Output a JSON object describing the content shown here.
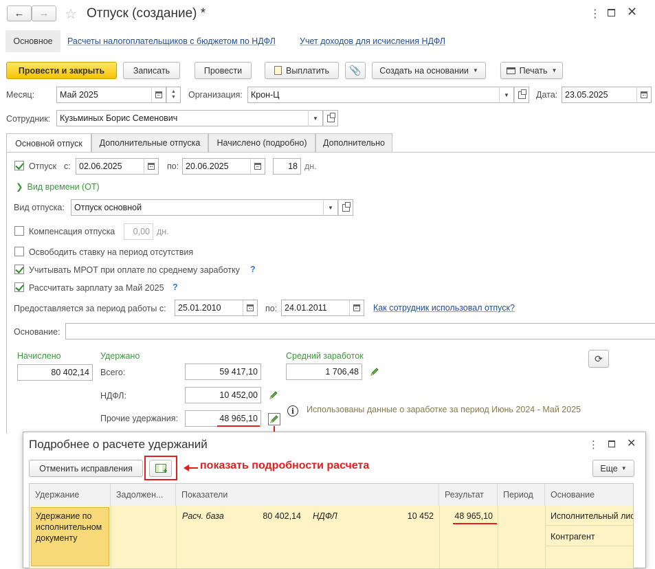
{
  "header": {
    "title": "Отпуск (создание) *",
    "nav_tabs": [
      "Основное",
      "Расчеты налогоплательщиков с бюджетом по НДФЛ",
      "Учет доходов для исчисления НДФЛ"
    ]
  },
  "toolbar": {
    "post_close": "Провести и закрыть",
    "save": "Записать",
    "post": "Провести",
    "pay": "Выплатить",
    "create_based": "Создать на основании",
    "print": "Печать"
  },
  "fields": {
    "month_label": "Месяц:",
    "month_value": "Май 2025",
    "org_label": "Организация:",
    "org_value": "Крон-Ц",
    "date_label": "Дата:",
    "date_value": "23.05.2025",
    "employee_label": "Сотрудник:",
    "employee_value": "Кузьминых Борис Семенович"
  },
  "tabs": [
    "Основной отпуск",
    "Дополнительные отпуска",
    "Начислено (подробно)",
    "Дополнительно"
  ],
  "vacation": {
    "label": "Отпуск",
    "from_label": "с:",
    "from_value": "02.06.2025",
    "to_label": "по:",
    "to_value": "20.06.2025",
    "days_value": "18",
    "days_unit": "дн.",
    "time_type": "Вид времени (ОТ)",
    "type_label": "Вид отпуска:",
    "type_value": "Отпуск основной",
    "compensation_label": "Компенсация отпуска",
    "compensation_value": "0,00",
    "compensation_unit": "дн.",
    "release_rate": "Освободить ставку на период отсутствия",
    "mrot": "Учитывать МРОТ при оплате по среднему заработку",
    "calc_salary": "Рассчитать зарплату за Май 2025",
    "q": "?",
    "period_label": "Предоставляется за период работы с:",
    "period_from": "25.01.2010",
    "period_to_label": "по:",
    "period_to": "24.01.2011",
    "how_used_link": "Как сотрудник использовал отпуск?",
    "basis_label": "Основание:"
  },
  "totals": {
    "accrued_label": "Начислено",
    "accrued_value": "80 402,14",
    "withheld_label": "Удержано",
    "total_label": "Всего:",
    "total_value": "59 417,10",
    "ndfl_label": "НДФЛ:",
    "ndfl_value": "10 452,00",
    "other_label": "Прочие удержания:",
    "other_value": "48 965,10",
    "avg_label": "Средний заработок",
    "avg_value": "1 706,48",
    "info_text": "Использованы данные о заработке за период Июнь 2024 - Май 2025"
  },
  "dialog": {
    "title": "Подробнее о расчете удержаний",
    "cancel_corrections": "Отменить исправления",
    "annotation": "показать подробности расчета",
    "more": "Еще",
    "columns": [
      "Удержание",
      "Задолжен...",
      "Показатели",
      "Результат",
      "Период",
      "Основание"
    ],
    "row": {
      "deduction": "Удержание по исполнительном документу",
      "indicator1_name": "Расч. база",
      "indicator1_value": "80 402,14",
      "indicator2_name": "НДФЛ",
      "indicator2_value": "10 452",
      "result": "48 965,10",
      "basis1": "Исполнительный лист",
      "basis2": "Контрагент"
    }
  },
  "colors": {
    "accent_yellow": "#f5c400",
    "green": "#3a9a3a",
    "link": "#1f4e9c",
    "red_annotation": "#e02020",
    "row_highlight": "#fdf3c4"
  }
}
